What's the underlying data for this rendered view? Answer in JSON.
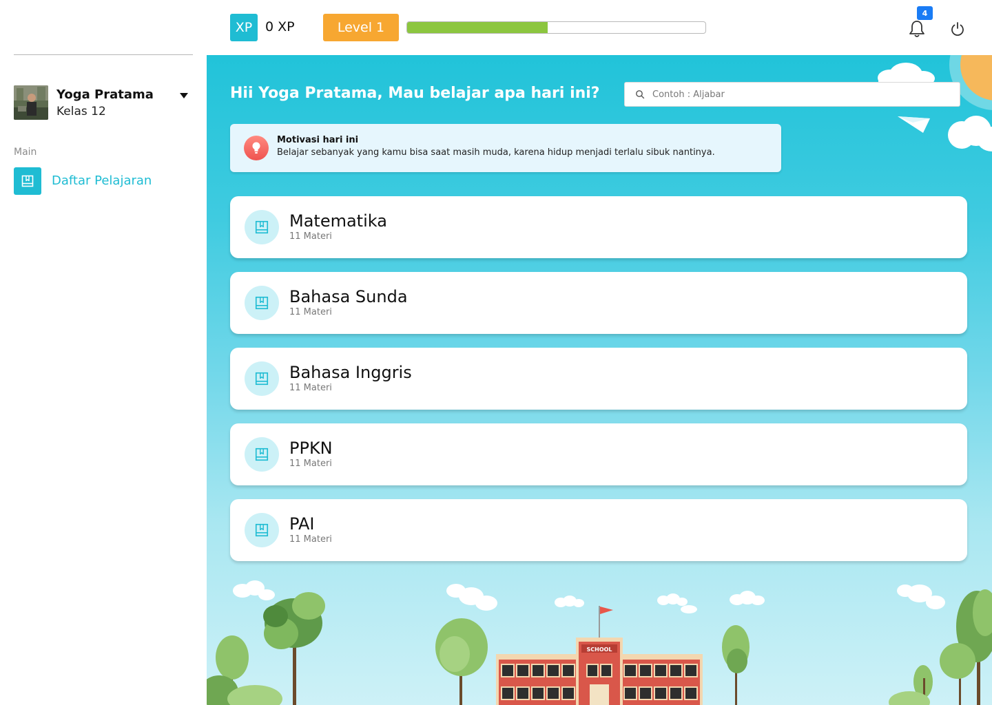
{
  "header": {
    "xp_icon_label": "XP",
    "xp_value": "0 XP",
    "level_label": "Level 1",
    "level_progress_percent": 47,
    "notification_count": "4",
    "notification_icon": "bell-icon",
    "logout_icon": "power-icon"
  },
  "sidebar": {
    "user": {
      "name": "Yoga Pratama",
      "class": "Kelas 12"
    },
    "section_label": "Main",
    "nav": [
      {
        "label": "Daftar Pelajaran",
        "icon": "book-icon",
        "active": true
      }
    ]
  },
  "main": {
    "greeting": "Hii Yoga Pratama, Mau belajar apa hari ini?",
    "search": {
      "placeholder": "Contoh : Aljabar"
    },
    "motivation": {
      "title": "Motivasi hari ini",
      "text": "Belajar sebanyak yang kamu bisa saat masih muda, karena hidup menjadi terlalu sibuk nantinya."
    },
    "subjects": [
      {
        "name": "Matematika",
        "count": "11 Materi"
      },
      {
        "name": "Bahasa Sunda",
        "count": "11 Materi"
      },
      {
        "name": "Bahasa Inggris",
        "count": "11 Materi"
      },
      {
        "name": "PPKN",
        "count": "11 Materi"
      },
      {
        "name": "PAI",
        "count": "11 Materi"
      }
    ],
    "illustration": {
      "school_sign": "SCHOOL"
    }
  },
  "colors": {
    "accent": "#1fbcd3",
    "level": "#f7a731",
    "progress": "#8cc63f",
    "badge": "#1a7cf5"
  }
}
